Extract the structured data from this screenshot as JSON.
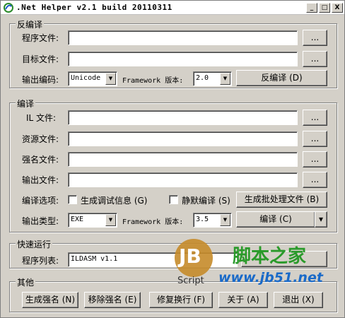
{
  "window": {
    "title": ".Net Helper v2.1 build 20110311",
    "buttons": {
      "minimize": "_",
      "maximize": "□",
      "close": "X"
    }
  },
  "decompile": {
    "group_label": "反编译",
    "program_file_label": "程序文件:",
    "program_file_value": "",
    "target_file_label": "目标文件:",
    "target_file_value": "",
    "browse_label": "...",
    "encoding_label": "输出编码:",
    "encoding_value": "Unicode",
    "framework_label": "Framework 版本:",
    "framework_value": "2.0",
    "decompile_button": "反编译 (D)"
  },
  "compile": {
    "group_label": "编译",
    "il_file_label": "IL 文件:",
    "resource_file_label": "资源文件:",
    "strong_name_file_label": "强名文件:",
    "output_file_label": "输出文件:",
    "browse_label": "...",
    "options_label": "编译选项:",
    "debug_info_label": "生成调试信息 (G)",
    "debug_info_checked": false,
    "silent_compile_label": "静默编译 (S)",
    "silent_compile_checked": false,
    "batch_button": "生成批处理文件 (B)",
    "output_type_label": "输出类型:",
    "output_type_value": "EXE",
    "framework_label": "Framework 版本:",
    "framework_value": "3.5",
    "compile_button": "编译 (C)",
    "split_arrow": "▾"
  },
  "quick_run": {
    "group_label": "快速运行",
    "program_list_label": "程序列表:",
    "program_list_value": "ILDASM v1.1"
  },
  "other": {
    "group_label": "其他",
    "buttons": [
      "生成强名 (N)",
      "移除强名 (E)",
      "修复换行 (F)",
      "关于 (A)",
      "退出 (X)"
    ]
  },
  "watermark": {
    "logo_text": "JB",
    "logo_sub": "Script",
    "site_name": "脚本之家",
    "site_url": "www.jb51.net"
  }
}
